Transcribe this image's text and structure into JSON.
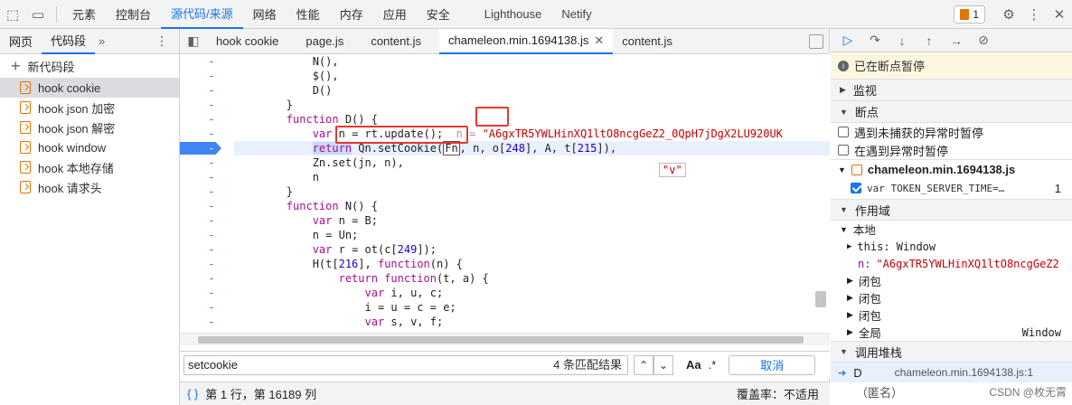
{
  "topbar": {
    "tabs": [
      "元素",
      "控制台",
      "源代码/来源",
      "网络",
      "性能",
      "内存",
      "应用",
      "安全",
      "Lighthouse",
      "Netify"
    ],
    "active_tab": "源代码/来源",
    "issues_count": "1",
    "icons": [
      "inspect-element-icon",
      "device-toolbar-icon",
      "settings-icon",
      "more-vert-icon",
      "close-icon"
    ]
  },
  "navigator": {
    "tabs": [
      "网页",
      "代码段"
    ],
    "more": "»",
    "new_snippet": "新代码段",
    "snippets": [
      "hook cookie",
      "hook json 加密",
      "hook json 解密",
      "hook window",
      "hook 本地存储",
      "hook 请求头"
    ],
    "selected": "hook cookie"
  },
  "file_tabs": [
    "hook cookie",
    "page.js",
    "content.js",
    "chameleon.min.1694138.js",
    "content.js"
  ],
  "active_file": "chameleon.min.1694138.js",
  "code_lines": [
    "            N(),",
    "            $(),",
    "            D()",
    "        }",
    "        function D() {",
    "            var n = rt.update();  n = \"A6gxTR5YWLHinXQ1ltO8ncgGeZ2_0QpH7jDgX2LU920UK",
    "            return Qn.setCookie(Fn, n, o[248], A, t[215]),",
    "            Zn.set(jn, n),",
    "            n",
    "        }",
    "        function N() {",
    "            var n = B;",
    "            n = Un;",
    "            var r = ot(c[249]);",
    "            H(t[216], function(n) {",
    "                return function(t, a) {",
    "                    var i, u, c;",
    "                    i = u = c = e;",
    "                    var s, v, f;"
  ],
  "gutter_mark": "-",
  "hover_value": "\"v\"",
  "search": {
    "query": "setcookie",
    "count": "4 条匹配结果",
    "up": "⌃",
    "down": "⌄",
    "case": "Aa",
    "regex": ".*",
    "cancel": "取消"
  },
  "status": {
    "position": "第 1 行，第 16189 列",
    "coverage": "覆盖率：不适用"
  },
  "debugger": {
    "paused": "已在断点暂停",
    "watch": "监视",
    "breakpoints": "断点",
    "pause_uncaught": "遇到未捕获的异常时暂停",
    "pause_caught": "在遇到异常时暂停",
    "bp_file": "chameleon.min.1694138.js",
    "bp_line_code": "var TOKEN_SERVER_TIME=…",
    "bp_line_num": "1",
    "scope": "作用域",
    "local": "本地",
    "this_label": "this: Window",
    "n_label": "n:",
    "n_value": "\"A6gxTR5YWLHinXQ1ltO8ncgGeZ2",
    "closures": [
      "闭包",
      "闭包",
      "闭包"
    ],
    "global": "全局",
    "global_value": "Window",
    "callstack": "调用堆栈",
    "frame_name": "D",
    "frame_loc": "chameleon.min.1694138.js:1",
    "frame_next": "（匿名）"
  },
  "watermark": "CSDN @枚无霄"
}
